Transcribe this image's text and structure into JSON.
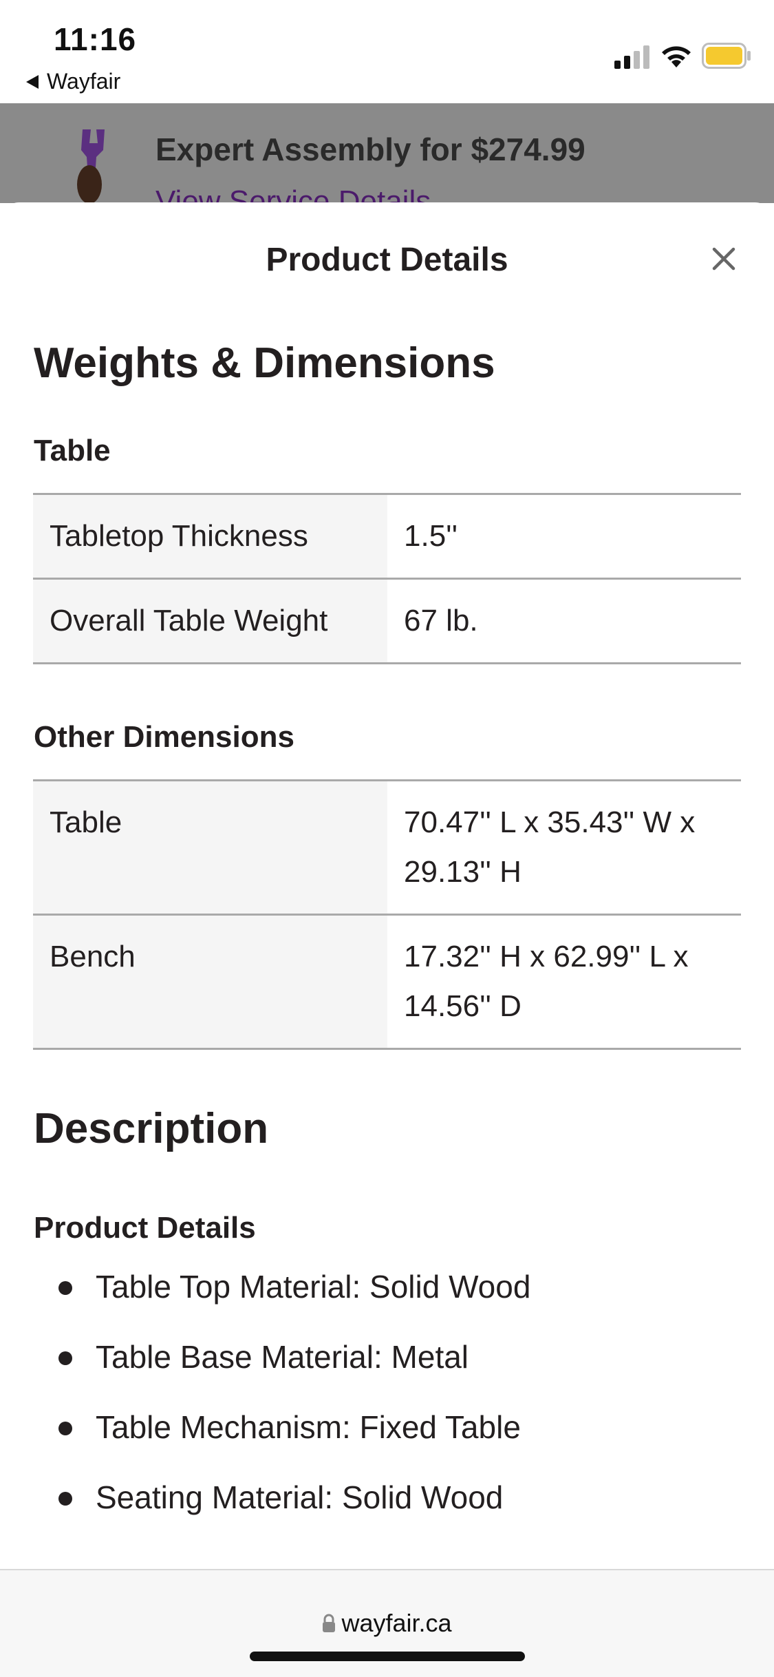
{
  "status_bar": {
    "time": "11:16",
    "back_app": "Wayfair"
  },
  "background_page": {
    "assembly_title": "Expert Assembly for $274.99",
    "assembly_link": "View Service Details"
  },
  "sheet": {
    "title": "Product Details",
    "close_icon": "close-icon",
    "weights_heading": "Weights & Dimensions",
    "table_subheading": "Table",
    "table_specs": [
      {
        "label": "Tabletop Thickness",
        "value": "1.5''"
      },
      {
        "label": "Overall Table Weight",
        "value": "67 lb."
      }
    ],
    "other_dimensions_subheading": "Other Dimensions",
    "other_dimensions": [
      {
        "label": "Table",
        "value": "70.47'' L x 35.43'' W x 29.13'' H"
      },
      {
        "label": "Bench",
        "value": "17.32'' H x 62.99'' L x 14.56'' D"
      }
    ],
    "description_heading": "Description",
    "product_details_subheading": "Product Details",
    "product_details": [
      "Table Top Material: Solid Wood",
      "Table Base Material: Metal",
      "Table Mechanism: Fixed Table",
      "Seating Material: Solid Wood"
    ]
  },
  "url_bar": {
    "domain": "wayfair.ca"
  },
  "colors": {
    "brand_purple": "#7f187f",
    "text": "#231f20",
    "table_label_bg": "#f5f5f5",
    "divider": "#a9a9a9"
  }
}
